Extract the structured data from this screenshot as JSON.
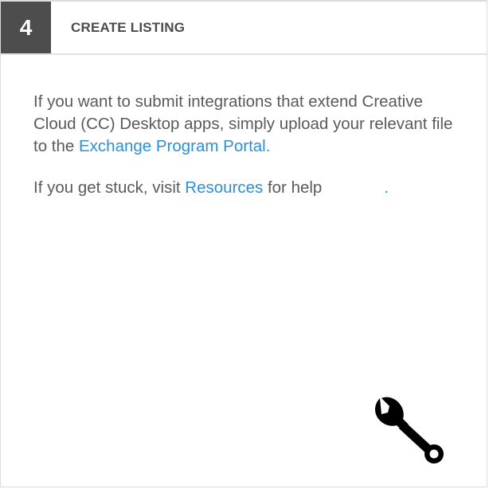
{
  "step": {
    "number": "4",
    "title": "CREATE LISTING"
  },
  "paragraph1": {
    "text_before": "If you want to submit integrations that extend Creative Cloud (CC) Desktop apps, simply upload your relevant file to the ",
    "link_label": "Exchange Program Portal",
    "text_after": "."
  },
  "paragraph2": {
    "text_before": "If you get stuck, visit ",
    "link_label": "Resources",
    "text_middle": " for help",
    "trailing_period": "."
  },
  "icons": {
    "tool": "wrench-icon"
  },
  "colors": {
    "step_badge": "#4d4d4d",
    "link": "#2d8fd5",
    "body_text": "#5a5a5a",
    "title_text": "#4b4b4b"
  }
}
